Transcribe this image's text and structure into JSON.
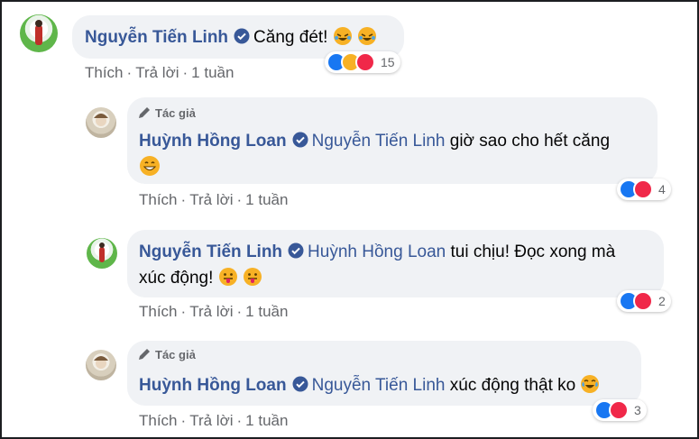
{
  "comments": [
    {
      "author": "Nguyễn Tiến Linh",
      "mention": "",
      "text": "Căng đét!",
      "emoji": "rolling-laughing-emoji x2",
      "actions": {
        "like": "Thích",
        "reply": "Trả lời",
        "time": "1 tuần"
      },
      "reaction_count": "15",
      "reactions": [
        "like",
        "haha",
        "love"
      ]
    },
    {
      "badge": "Tác giả",
      "author": "Huỳnh Hồng Loan",
      "mention": "Nguyễn Tiến Linh",
      "text": "giờ sao cho hết căng",
      "emoji": "grinning-emoji",
      "actions": {
        "like": "Thích",
        "reply": "Trả lời",
        "time": "1 tuần"
      },
      "reaction_count": "4",
      "reactions": [
        "like",
        "love"
      ]
    },
    {
      "author": "Nguyễn Tiến Linh",
      "mention": "Huỳnh Hồng Loan",
      "text_line1": "tui chịu! Đọc xong mà",
      "text_line2": "xúc động!",
      "emoji": "tongue-out-emoji x2",
      "actions": {
        "like": "Thích",
        "reply": "Trả lời",
        "time": "1 tuần"
      },
      "reaction_count": "2",
      "reactions": [
        "like",
        "love"
      ]
    },
    {
      "badge": "Tác giả",
      "author": "Huỳnh Hồng Loan",
      "mention": "Nguyễn Tiến Linh",
      "text": "xúc động thật ko",
      "emoji": "tears-of-joy-emoji",
      "actions": {
        "like": "Thích",
        "reply": "Trả lời",
        "time": "1 tuần"
      },
      "reaction_count": "3",
      "reactions": [
        "like",
        "love"
      ]
    }
  ],
  "colors": {
    "name_link": "#385898",
    "bubble": "#f0f2f5",
    "meta": "#65676b",
    "like": "#1877f2",
    "love": "#f02849",
    "haha": "#f7b125"
  }
}
